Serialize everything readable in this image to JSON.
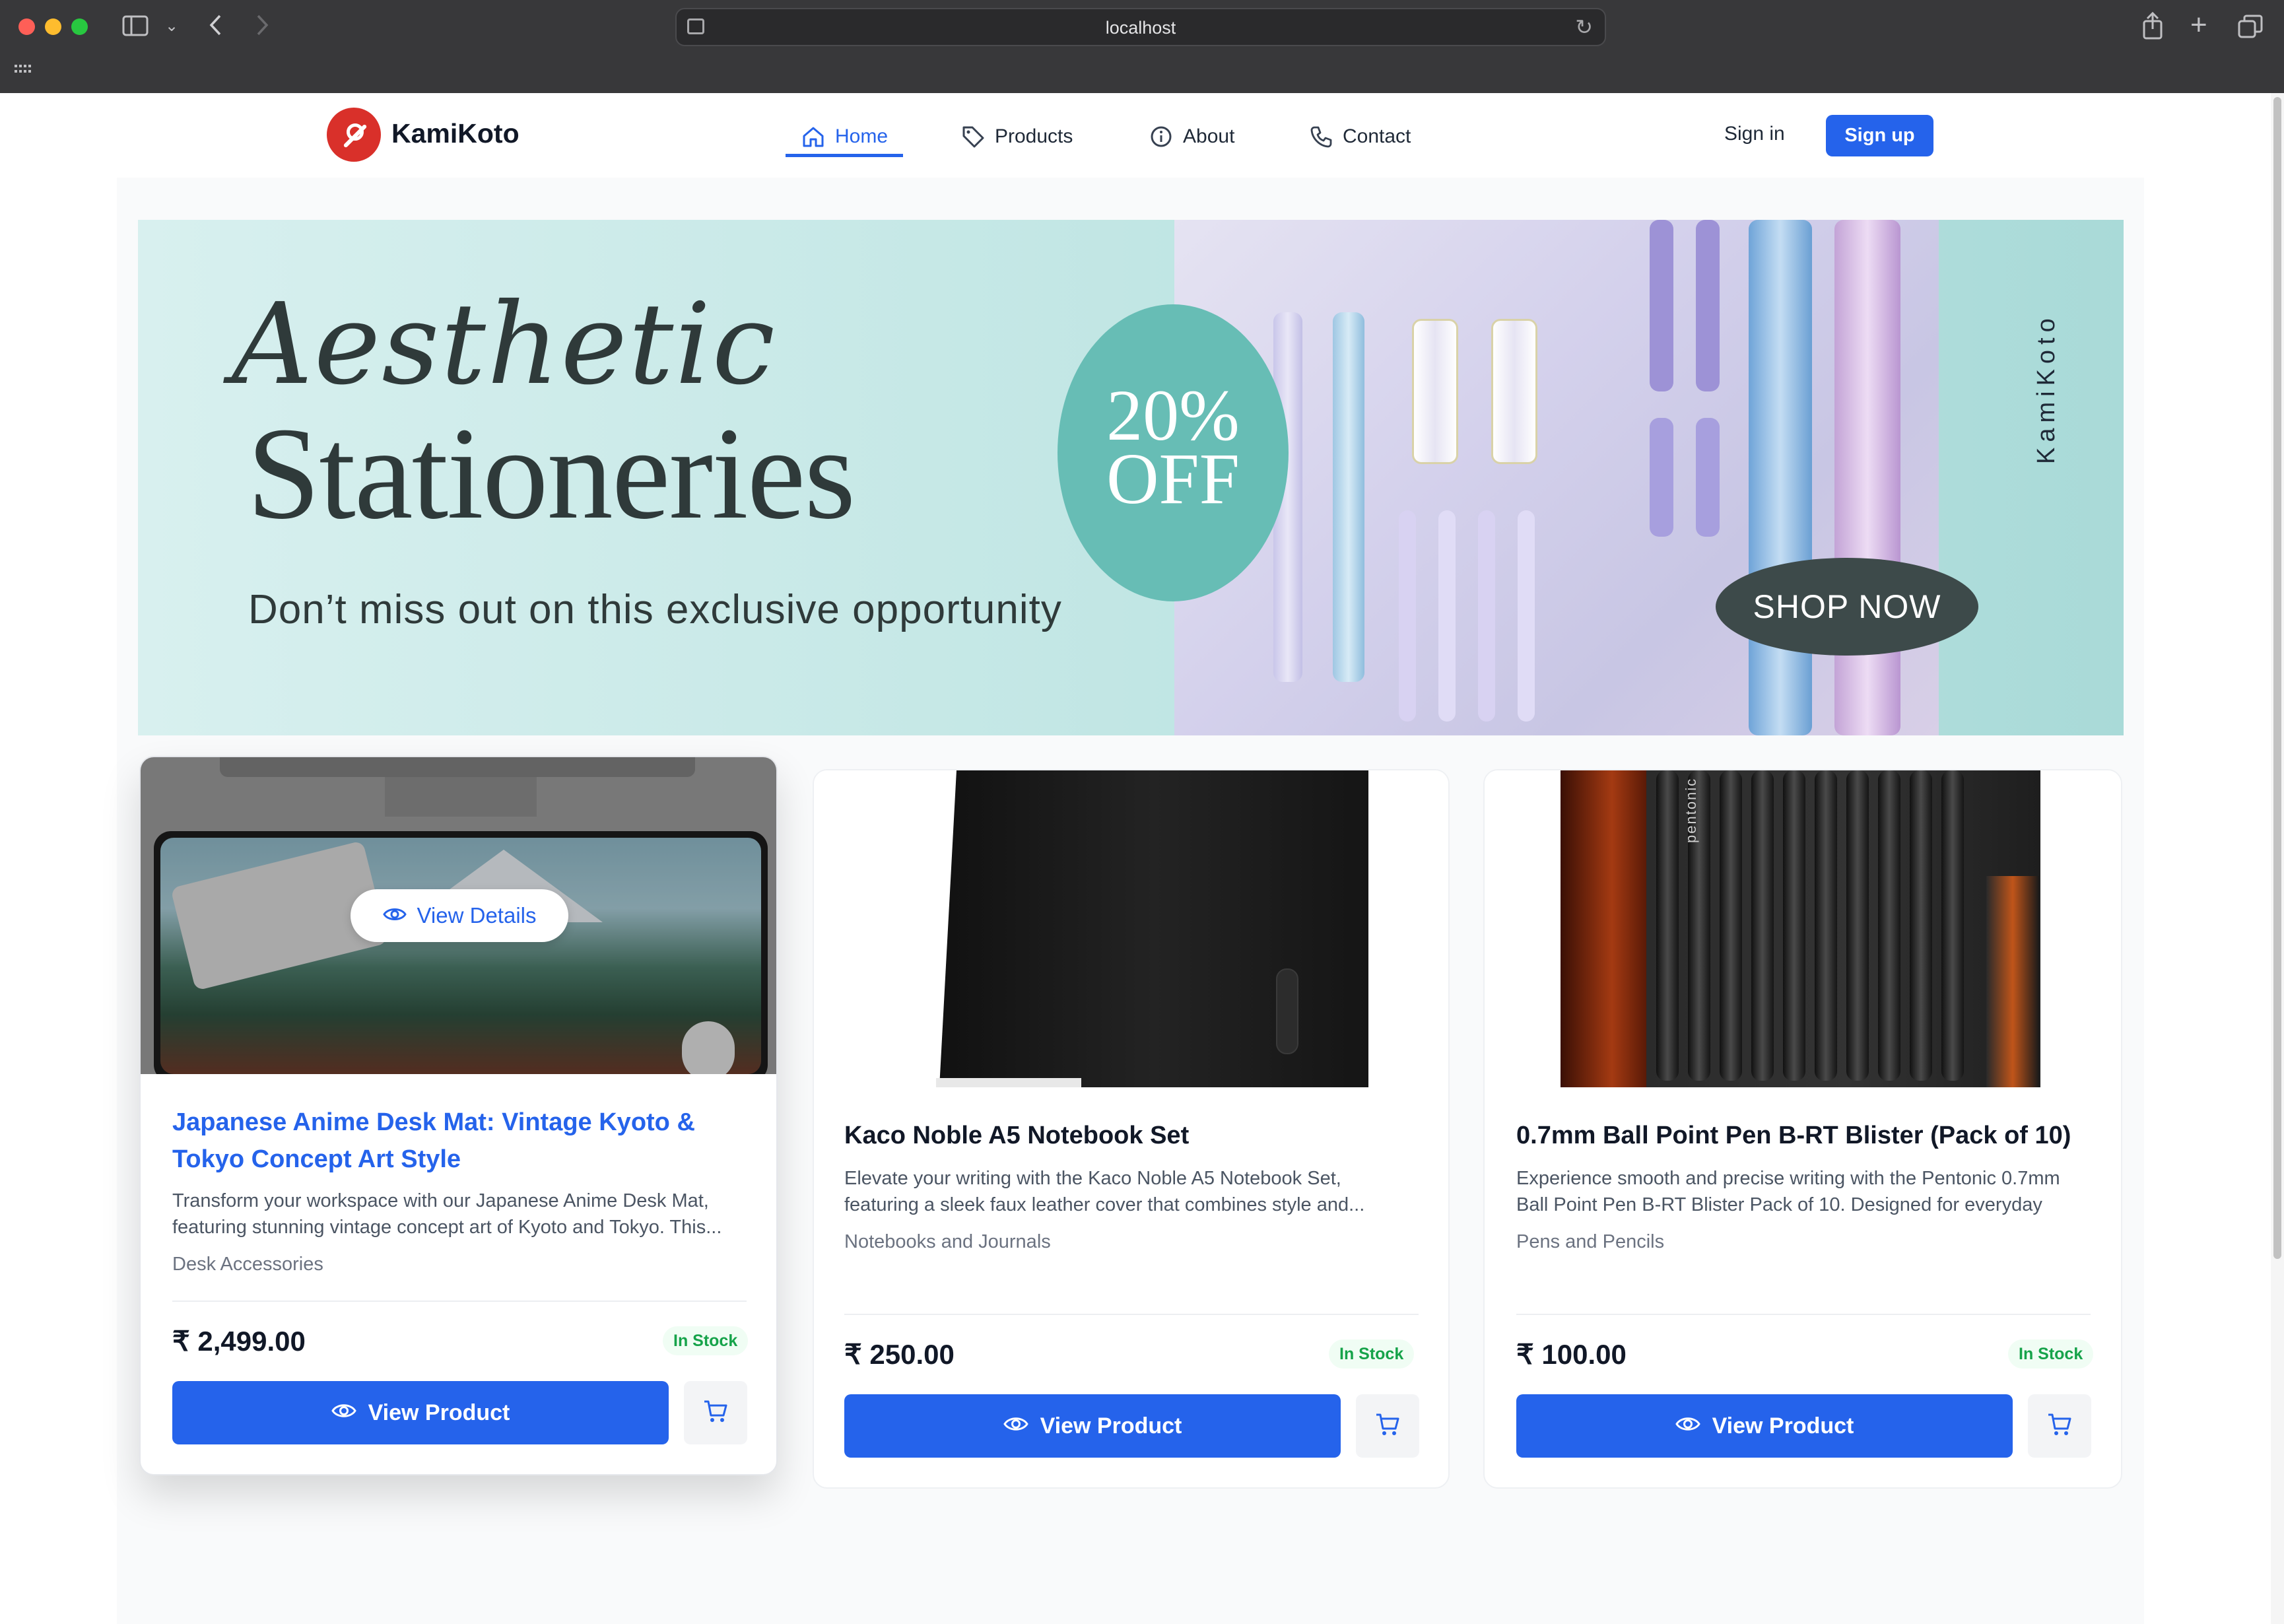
{
  "browser": {
    "url": "localhost"
  },
  "header": {
    "brand": "KamiKoto",
    "nav": [
      {
        "label": "Home",
        "icon": "home-icon",
        "active": true
      },
      {
        "label": "Products",
        "icon": "tag-icon",
        "active": false
      },
      {
        "label": "About",
        "icon": "info-icon",
        "active": false
      },
      {
        "label": "Contact",
        "icon": "phone-icon",
        "active": false
      }
    ],
    "signin_label": "Sign in",
    "signup_label": "Sign up"
  },
  "banner": {
    "script_text": "Aesthetic",
    "title": "Stationeries",
    "subtitle": "Don’t miss out on this exclusive opportunity",
    "badge_line1": "20%",
    "badge_line2": "OFF",
    "cta": "SHOP NOW",
    "vertical_brand": "KamiKoto"
  },
  "products": [
    {
      "title": "Japanese Anime Desk Mat: Vintage Kyoto & Tokyo Concept Art Style",
      "description": "Transform your workspace with our Japanese Anime Desk Mat, featuring stunning vintage concept art of Kyoto and Tokyo. This...",
      "category": "Desk Accessories",
      "price": "₹ 2,499.00",
      "stock": "In Stock",
      "view_label": "View Product",
      "overlay_label": "View Details"
    },
    {
      "title": "Kaco Noble A5 Notebook Set",
      "description": "Elevate your writing with the Kaco Noble A5 Notebook Set, featuring a sleek faux leather cover that combines style and...",
      "category": "Notebooks and Journals",
      "price": "₹ 250.00",
      "stock": "In Stock",
      "view_label": "View Product"
    },
    {
      "title": "0.7mm Ball Point Pen B-RT Blister (Pack of 10)",
      "description": "Experience smooth and precise writing with the Pentonic 0.7mm Ball Point Pen B-RT Blister Pack of 10. Designed for everyday use,...",
      "category": "Pens and Pencils",
      "price": "₹ 100.00",
      "stock": "In Stock",
      "view_label": "View Product",
      "image_text": "pentonic"
    }
  ],
  "colors": {
    "primary": "#2563eb",
    "stock_green": "#16a34a",
    "banner_teal": "#67bdb5"
  }
}
